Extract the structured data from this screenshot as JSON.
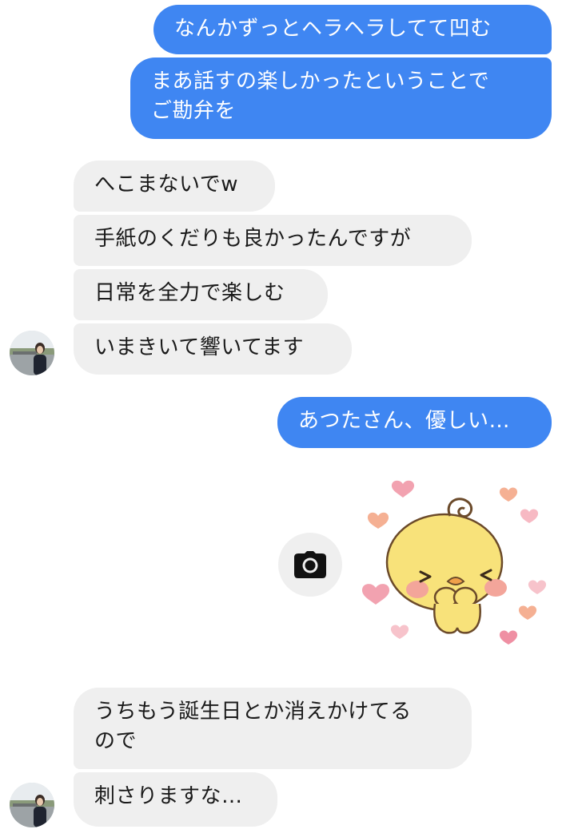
{
  "messages": [
    {
      "side": "out",
      "text": "なんかずっとヘラヘラしてて凹む"
    },
    {
      "side": "out",
      "text": "まあ話すの楽しかったということで\nご勘弁を"
    },
    {
      "side": "in",
      "text": "へこまないでw"
    },
    {
      "side": "in",
      "text": "手紙のくだりも良かったんですが"
    },
    {
      "side": "in",
      "text": "日常を全力で楽しむ"
    },
    {
      "side": "in",
      "text": "いまきいて響いてます"
    },
    {
      "side": "out",
      "text": "あつたさん、優しい…"
    },
    {
      "side": "in",
      "text": "うちもう誕生日とか消えかけてる\nので"
    },
    {
      "side": "in",
      "text": "刺さりますな…"
    }
  ],
  "icons": {
    "camera": "camera-icon",
    "avatar": "contact-avatar",
    "sticker": "chick-heart-sticker"
  },
  "colors": {
    "outgoing_bubble": "#3f86f2",
    "incoming_bubble": "#efefef",
    "sticker_body": "#f8e27a",
    "sticker_hearts": "#f2a2b0"
  }
}
